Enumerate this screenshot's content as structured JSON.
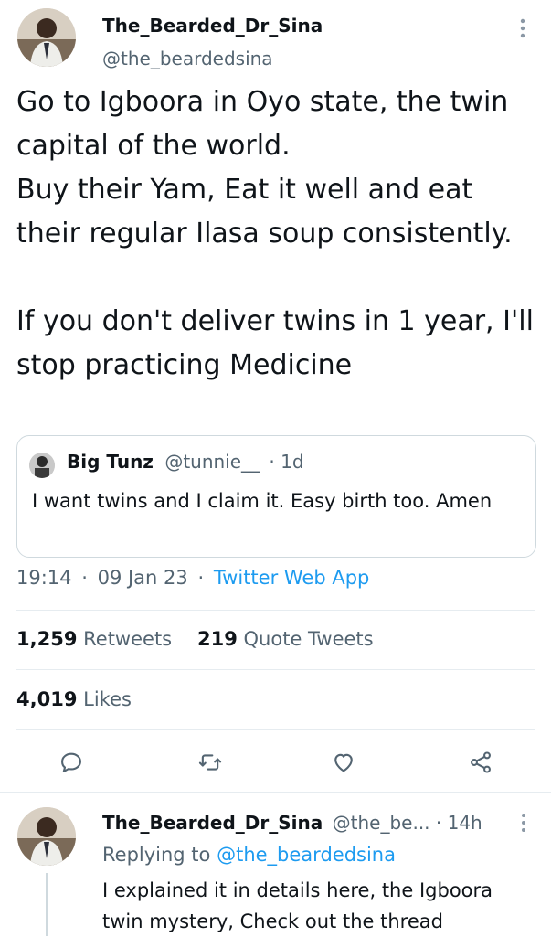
{
  "tweet": {
    "display_name": "The_Bearded_Dr_Sina",
    "handle": "@the_beardedsina",
    "text": "Go to Igboora in Oyo state, the twin capital of the world.\nBuy their Yam, Eat it well and eat their regular Ilasa soup consistently.\n\nIf you don't deliver twins in 1 year, I'll stop practicing Medicine",
    "quote": {
      "display_name": "Big Tunz",
      "handle": "@tunnie__",
      "time": "· 1d",
      "text": "I want twins and I claim it. Easy birth too. Amen"
    },
    "time": "19:14",
    "dot": "·",
    "date": "09 Jan 23",
    "source": "Twitter Web App",
    "retweets_count": "1,259",
    "retweets_label": "Retweets",
    "quotes_count": "219",
    "quotes_label": "Quote Tweets",
    "likes_count": "4,019",
    "likes_label": "Likes"
  },
  "reply": {
    "display_name": "The_Bearded_Dr_Sina",
    "handle_time": "@the_be... · 14h",
    "replying_prefix": "Replying to",
    "replying_handle": "@the_beardedsina",
    "text": "I explained it in details here, the Igboora twin mystery, Check out the thread"
  },
  "icons": [
    "more-vertical-icon",
    "reply-icon",
    "retweet-icon",
    "like-icon",
    "share-icon"
  ],
  "colors": {
    "accent": "#1d9bf0",
    "text": "#0f1419",
    "muted": "#536471",
    "border": "#cfd9de"
  }
}
